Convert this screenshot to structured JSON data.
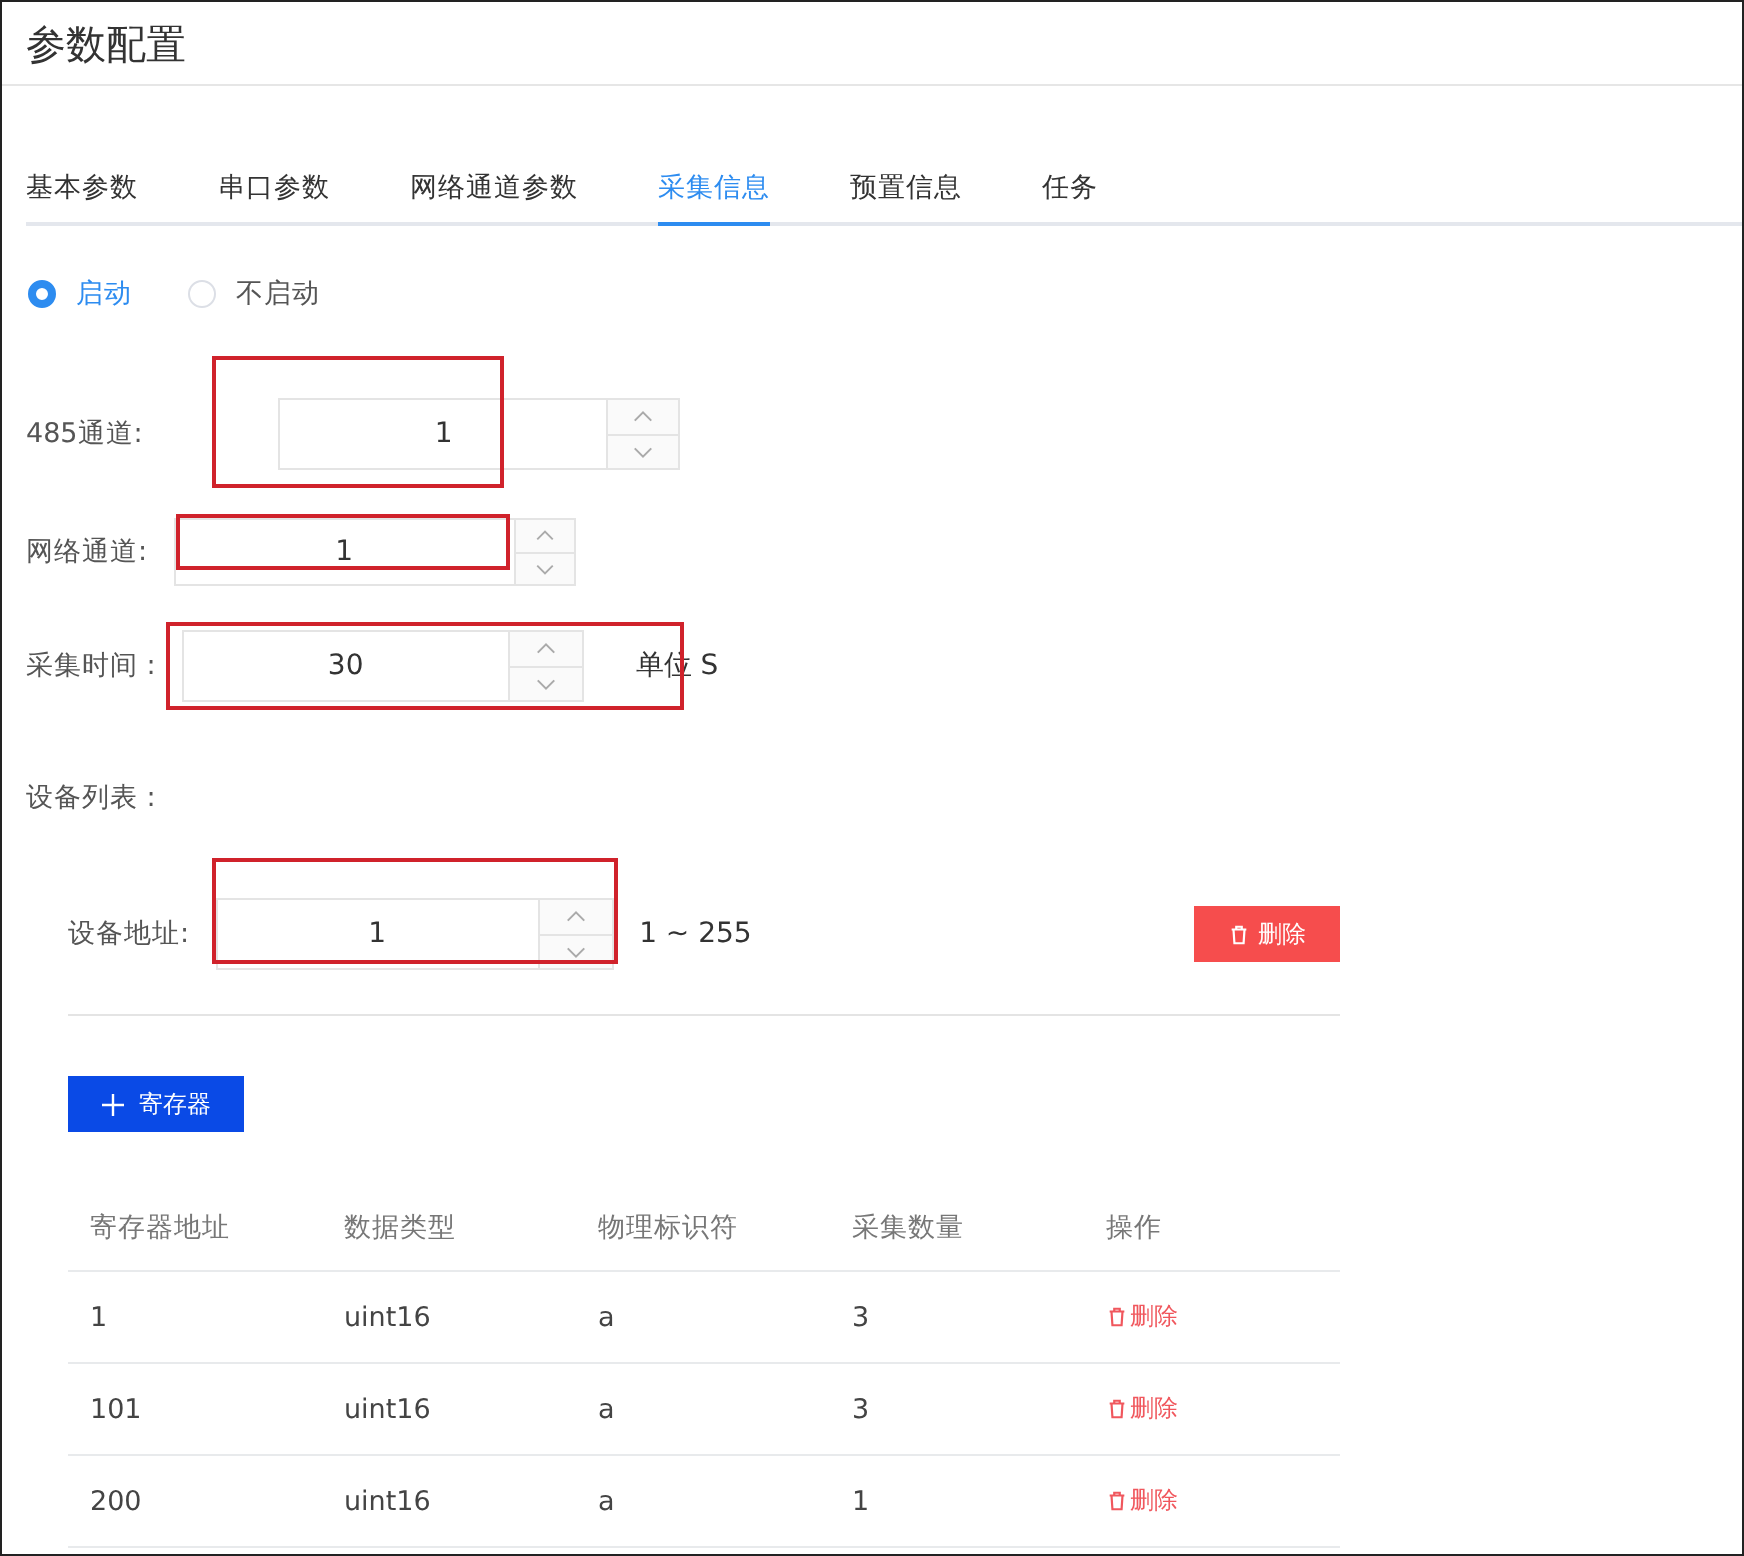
{
  "window": {
    "title": "参数配置"
  },
  "tabs": [
    {
      "label": "基本参数",
      "selected": false
    },
    {
      "label": "串口参数",
      "selected": false
    },
    {
      "label": "网络通道参数",
      "selected": false
    },
    {
      "label": "采集信息",
      "selected": true
    },
    {
      "label": "预置信息",
      "selected": false
    },
    {
      "label": "任务",
      "selected": false
    }
  ],
  "radios": [
    {
      "label": "启动",
      "selected": true
    },
    {
      "label": "不启动",
      "selected": false
    }
  ],
  "fields": [
    {
      "label": "485通道:",
      "value": "1",
      "highlighted": true
    },
    {
      "label": "网络通道:",
      "value": "1",
      "highlighted": true
    },
    {
      "label": "采集时间 :",
      "value": "30",
      "unit": "单位 S",
      "highlighted": true
    }
  ],
  "device_list_label": "设备列表 :",
  "device": {
    "label": "设备地址:",
    "value": "1",
    "range": "1 ~ 255",
    "highlighted": true,
    "delete_button": "删除"
  },
  "add_button": "寄存器",
  "table": {
    "columns": [
      "寄存器地址",
      "数据类型",
      "物理标识符",
      "采集数量",
      "操作"
    ],
    "rows": [
      {
        "cells": [
          "1",
          "uint16",
          "a",
          "3"
        ],
        "action": "删除"
      },
      {
        "cells": [
          "101",
          "uint16",
          "a",
          "3"
        ],
        "action": "删除"
      },
      {
        "cells": [
          "200",
          "uint16",
          "a",
          "1"
        ],
        "action": "删除"
      }
    ]
  }
}
